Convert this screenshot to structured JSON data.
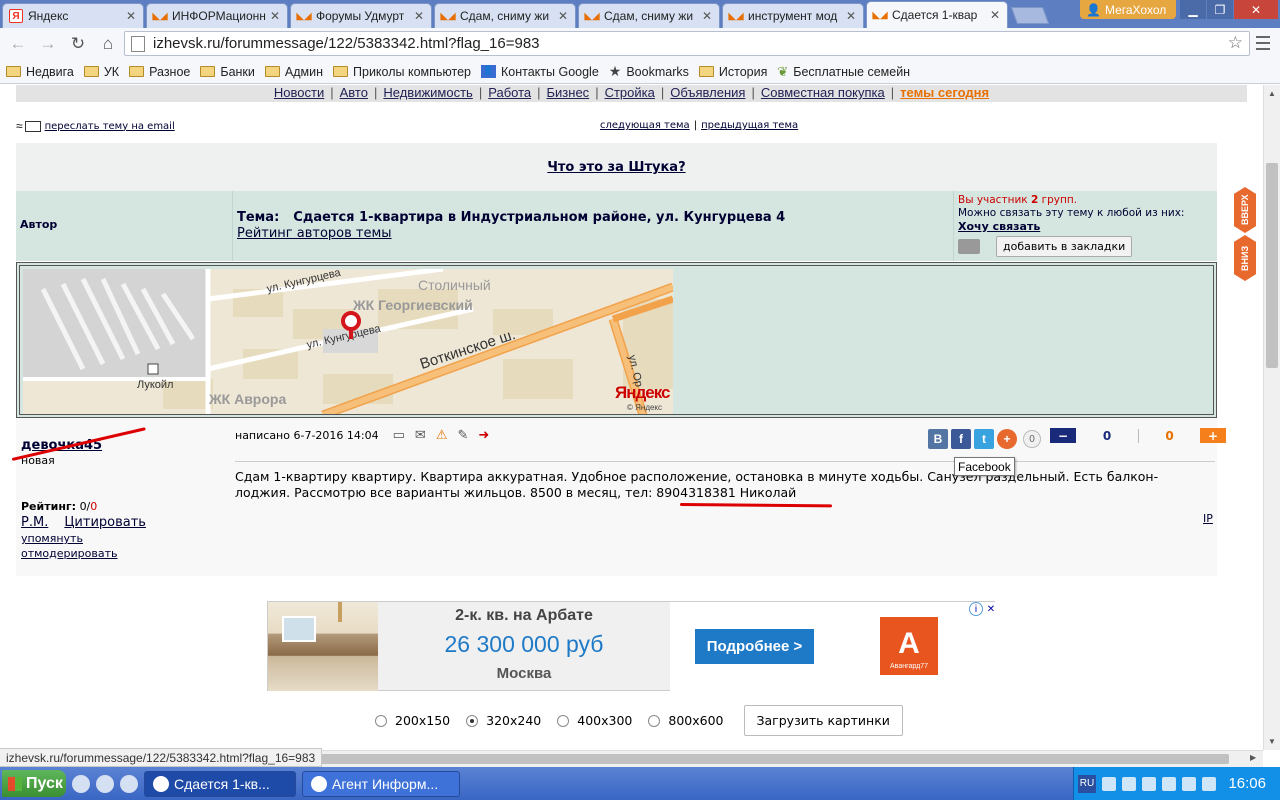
{
  "browser": {
    "tabs": [
      {
        "title": "Яндекс",
        "favicon": "yandex-icon",
        "active": false
      },
      {
        "title": "ИНФОРМационн",
        "favicon": "izhevsk-icon",
        "active": false
      },
      {
        "title": "Форумы Удмурт",
        "favicon": "izhevsk-icon",
        "active": false
      },
      {
        "title": "Сдам, сниму жи",
        "favicon": "izhevsk-icon",
        "active": false
      },
      {
        "title": "Сдам, сниму жи",
        "favicon": "izhevsk-icon",
        "active": false
      },
      {
        "title": "инструмент мод",
        "favicon": "izhevsk-icon",
        "active": false
      },
      {
        "title": "Сдается 1-квар",
        "favicon": "izhevsk-icon",
        "active": true
      }
    ],
    "profile_name": "МегаХохол",
    "url": "izhevsk.ru/forummessage/122/5383342.html?flag_16=983",
    "bookmarks": [
      {
        "label": "Недвига",
        "icon": "folder-icon"
      },
      {
        "label": "УК",
        "icon": "folder-icon"
      },
      {
        "label": "Разное",
        "icon": "folder-icon"
      },
      {
        "label": "Банки",
        "icon": "folder-icon"
      },
      {
        "label": "Админ",
        "icon": "folder-icon"
      },
      {
        "label": "Приколы компьютер",
        "icon": "folder-icon"
      },
      {
        "label": "Контакты Google",
        "icon": "google-contacts-icon"
      },
      {
        "label": "Bookmarks",
        "icon": "star-icon"
      },
      {
        "label": "История",
        "icon": "folder-icon"
      },
      {
        "label": "Бесплатные семейн",
        "icon": "leaf-icon"
      }
    ],
    "status_url": "izhevsk.ru/forummessage/122/5383342.html?flag_16=983"
  },
  "site_nav": {
    "items": [
      "Новости",
      "Авто",
      "Недвижимость",
      "Работа",
      "Бизнес",
      "Стройка",
      "Объявления",
      "Совместная покупка"
    ],
    "hot": "темы сегодня"
  },
  "forward_email": "переслать тему на email",
  "topic_nav": {
    "next": "следующая тема",
    "prev": "предыдущая тема"
  },
  "shtuka_link": "Что это за Штука?",
  "topic_header": {
    "author_label": "Автор",
    "topic_label": "Тема:",
    "topic_title": "Сдается 1-квартира в Индустриальном районе, ул. Кунгурцева 4",
    "rating_link": "Рейтинг авторов темы",
    "groups_line_pre": "Вы участник ",
    "groups_count": "2",
    "groups_line_post": " групп.",
    "groups_hint": "Можно связать эту тему к любой из них:",
    "want_link": "Хочу связать",
    "bookmark_button": "добавить в закладки"
  },
  "side_tabs": {
    "up": "ВВЕРХ",
    "down": "ВНИЗ"
  },
  "map": {
    "labels": {
      "street1": "ул. Кунгурцева",
      "street1b": "ул. Кунгурцева",
      "district": "Столичный",
      "complex1": "ЖК Георгиевский",
      "highway": "Воткинское ш.",
      "poi": "Лукойл",
      "complex2": "ЖК Аврора",
      "street2": "ул. Ор",
      "brand": "Яндекс",
      "copyright": "© Яндекс"
    }
  },
  "post": {
    "username": "девочка45",
    "status": "новая",
    "rating_label": "Рейтинг:",
    "rating_value": "0/",
    "rating_zero": "0",
    "pm_link": "Р.М.",
    "quote_link": "Цитировать",
    "mention_link": "упомянуть",
    "moderate_link": "отмодерировать",
    "written": "написано 6-7-2016 14:04",
    "body": "Сдам 1-квартиру квартиру. Квартира аккуратная. Удобное расположение, остановка в минуте ходьбы. Санузел раздельный. Есть балкон-лоджия. Рассмотрю все варианты жильцов. 8500 в месяц, тел: 8904318381 Николай",
    "ip_link": "IP",
    "share": {
      "vk": "В",
      "fb": "f",
      "tw": "t",
      "plus": "+",
      "count": "0"
    },
    "votes": {
      "minus_label": "−",
      "negative": "0",
      "positive": "0",
      "plus_label": "+"
    },
    "tooltip": "Facebook"
  },
  "ad": {
    "title": "2-к. кв. на Арбате",
    "price": "26 300 000 руб",
    "city": "Москва",
    "button": "Подробнее >",
    "logo_letter": "А",
    "logo_text": "Авангард77"
  },
  "image_sizes": {
    "options": [
      "200x150",
      "320x240",
      "400x300",
      "800x600"
    ],
    "selected": "320x240",
    "upload_button": "Загрузить картинки"
  },
  "taskbar": {
    "start": "Пуск",
    "tasks": [
      {
        "label": "Сдается 1-кв...",
        "active": true
      },
      {
        "label": "Агент Информ...",
        "active": false
      }
    ],
    "lang": "RU",
    "clock": "16:06"
  }
}
